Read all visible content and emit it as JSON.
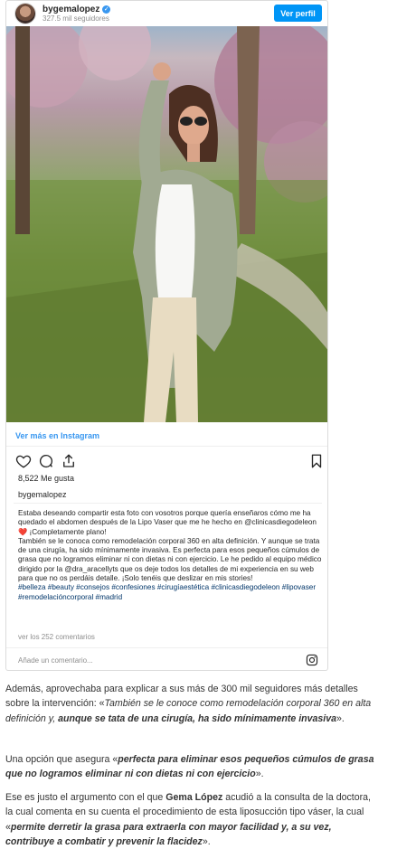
{
  "embed": {
    "username": "bygemalopez",
    "followers": "327.5 mil seguidores",
    "view_profile": "Ver perfil",
    "view_more": "Ver más en Instagram",
    "likes": "8,522 Me gusta",
    "owner": "bygemalopez",
    "caption": {
      "p1": "Estaba deseando compartir esta foto con vosotros porque quería enseñaros cómo me ha quedado el abdomen después de la Lipo Vaser que me he hecho en @clinicasdiegodeleon ❤️ ¡Completamente plano!",
      "p2": "También se le conoca como remodelación corporal 360 en alta definición. Y aunque se trata de una cirugía, ha sido mínimamente invasiva. Es perfecta para esos pequeños cúmulos de grasa que no logramos eliminar ni con dietas ni con ejercicio. Le he pedido al equipo médico dirigido por la @dra_aracellyts que os deje todos los detalles de mi experiencia en su web para que no os perdáis detalle. ¡Solo tenéis que deslizar en mis stories!",
      "hashtags": "#belleza #beauty #consejos #confesiones #cirugíaestética #clinicasdiegodeleon #lipovaser #remodelacióncorporal #madrid"
    },
    "comments_link": "ver los 252 comentarios",
    "add_comment_placeholder": "Añade un comentario...",
    "icons": [
      "heart-icon",
      "comment-icon",
      "share-icon",
      "bookmark-icon",
      "instagram-icon",
      "verified-icon"
    ],
    "accent_color": "#0095f6"
  },
  "article": {
    "p1_a": "Además, aprovechaba para explicar a sus más de 300 mil seguidores más detalles sobre la intervención: «",
    "p1_i": "También se le conoce como remodelación corporal 360 en alta definición y,",
    "p1_bi": " aunque se tata de una cirugía, ha sido mínimamente invasiva",
    "p1_end": "».",
    "p2_a": "Una opción que asegura «",
    "p2_bi": "perfecta para eliminar esos pequeños cúmulos de grasa que no logramos eliminar ni con dietas ni con ejercicio",
    "p2_end": "».",
    "p3_a": "Ese es justo el argumento con el que ",
    "p3_b": "Gema López",
    "p3_c": " acudió a la consulta de la doctora, la cual comenta en su cuenta el procedimiento de esta liposucción tipo váser, la cual «",
    "p3_bi": "permite derretir la grasa para extraerla con mayor facilidad y, a su vez, contribuye a combatir y prevenir la flacidez",
    "p3_end": "»."
  }
}
